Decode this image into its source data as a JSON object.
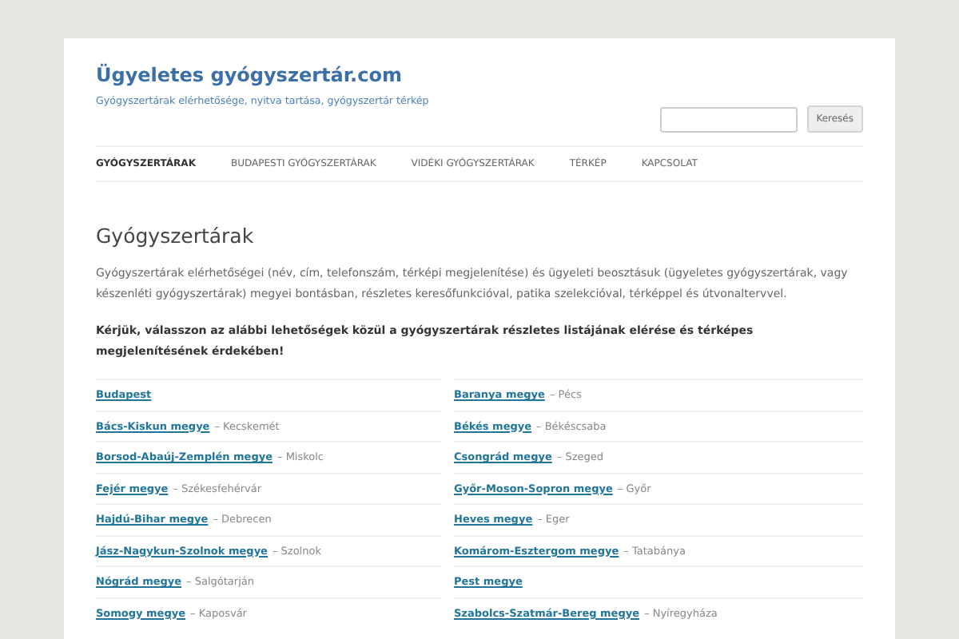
{
  "site": {
    "title": "Ügyeletes gyógyszertár.com",
    "tagline": "Gyógyszertárak elérhetősége, nyitva tartása, gyógyszertár térkép"
  },
  "search": {
    "button": "Keresés"
  },
  "nav": [
    {
      "label": "GYÓGYSZERTÁRAK",
      "selected": true
    },
    {
      "label": "BUDAPESTI GYÓGYSZERTÁRAK",
      "selected": false
    },
    {
      "label": "VIDÉKI GYÓGYSZERTÁRAK",
      "selected": false
    },
    {
      "label": "TÉRKÉP",
      "selected": false
    },
    {
      "label": "KAPCSOLAT",
      "selected": false
    }
  ],
  "page": {
    "heading": "Gyógyszertárak",
    "intro": "Gyógyszertárak elérhetőségei (név, cím, telefonszám, térképi megjelenítése) és ügyeleti beosztásuk (ügyeletes gyógyszertárak, vagy készenléti gyógyszertárak) megyei bontásban, részletes keresőfunkcióval, patika szelekcióval, térképpel és útvonaltervvel.",
    "prompt": "Kérjük, válasszon az alábbi lehetőségek közül a gyógyszertárak részletes listájának elérése és térképes megjelenítésének érdekében!"
  },
  "regions": [
    {
      "link": "Budapest"
    },
    {
      "link": "Baranya megye",
      "city": "– Pécs"
    },
    {
      "link": "Bács-Kiskun megye",
      "city": "– Kecskemét"
    },
    {
      "link": "Békés megye",
      "city": "– Békéscsaba"
    },
    {
      "link": "Borsod-Abaúj-Zemplén megye",
      "city": "– Miskolc"
    },
    {
      "link": "Csongrád megye",
      "city": "– Szeged"
    },
    {
      "link": "Fejér megye",
      "city": "– Székesfehérvár"
    },
    {
      "link": "Győr-Moson-Sopron megye",
      "city": "– Győr"
    },
    {
      "link": "Hajdú-Bihar megye",
      "city": "– Debrecen"
    },
    {
      "link": "Heves megye",
      "city": "– Eger"
    },
    {
      "link": "Jász-Nagykun-Szolnok megye",
      "city": "– Szolnok"
    },
    {
      "link": "Komárom-Esztergom megye",
      "city": "– Tatabánya"
    },
    {
      "link": "Nógrád megye",
      "city": "– Salgótarján"
    },
    {
      "link": "Pest megye"
    },
    {
      "link": "Somogy megye",
      "city": "– Kaposvár"
    },
    {
      "link": "Szabolcs-Szatmár-Bereg megye",
      "city": "– Nyíregyháza"
    }
  ]
}
